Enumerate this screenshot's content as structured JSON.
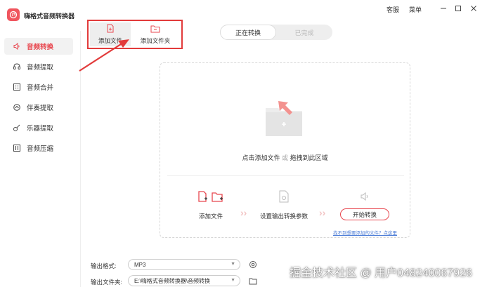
{
  "app": {
    "title": "嗨格式音频转换器",
    "service_label": "客服",
    "menu_label": "菜单"
  },
  "sidebar": {
    "items": [
      {
        "label": "音频转换",
        "icon": "speaker-icon",
        "active": true
      },
      {
        "label": "音频提取",
        "icon": "extract-icon",
        "active": false
      },
      {
        "label": "音频合并",
        "icon": "merge-icon",
        "active": false
      },
      {
        "label": "伴奏提取",
        "icon": "headset-icon",
        "active": false
      },
      {
        "label": "乐器提取",
        "icon": "guitar-icon",
        "active": false
      },
      {
        "label": "音频压缩",
        "icon": "compress-icon",
        "active": false
      }
    ]
  },
  "toolbar": {
    "add_file_label": "添加文件",
    "add_folder_label": "添加文件夹"
  },
  "tabs": {
    "converting": "正在转换",
    "completed": "已完成"
  },
  "dropzone": {
    "hint_main": "点击添加文件",
    "hint_or": "或",
    "hint_drag": "拖拽到此区域",
    "steps": {
      "add_file": "添加文件",
      "set_params": "设置输出转换参数",
      "start": "开始转换"
    },
    "help_link": "找不到想要添加的文件？点这里"
  },
  "settings": {
    "format_label": "输出格式:",
    "format_value": "MP3",
    "folder_label": "输出文件夹:",
    "folder_value": "E:\\嗨格式音频转换器\\音频转换"
  },
  "watermark": "掘金技术社区 @ 用户048240067926",
  "colors": {
    "accent": "#e8474f",
    "highlight_box": "#e23b3b",
    "arrow": "#e23b3b",
    "link": "#4a7bd6"
  }
}
